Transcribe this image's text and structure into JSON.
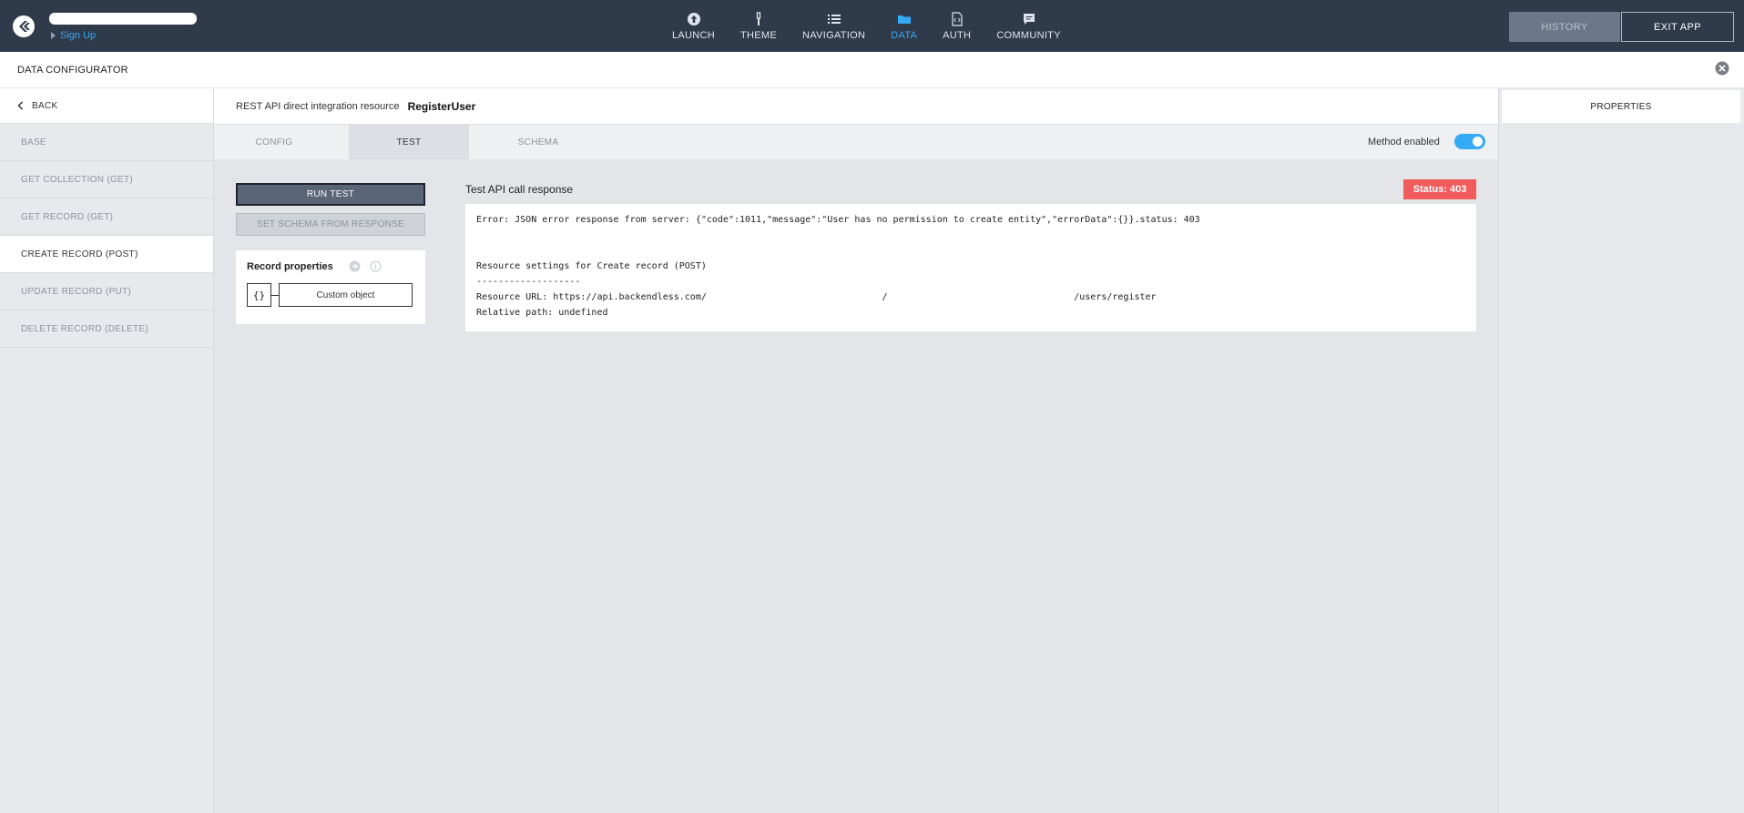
{
  "topbar": {
    "sign_up": "Sign Up",
    "nav": [
      {
        "label": "LAUNCH",
        "icon": "upload-icon"
      },
      {
        "label": "THEME",
        "icon": "brush-icon"
      },
      {
        "label": "NAVIGATION",
        "icon": "list-icon"
      },
      {
        "label": "DATA",
        "icon": "folder-icon",
        "active": true
      },
      {
        "label": "AUTH",
        "icon": "code-file-icon"
      },
      {
        "label": "COMMUNITY",
        "icon": "chat-icon"
      }
    ],
    "history_label": "HISTORY",
    "exit_label": "EXIT APP"
  },
  "configurator": {
    "title": "DATA CONFIGURATOR"
  },
  "sidebar": {
    "back_label": "BACK",
    "items": [
      {
        "label": "BASE"
      },
      {
        "label": "GET COLLECTION (GET)"
      },
      {
        "label": "GET RECORD (GET)"
      },
      {
        "label": "CREATE RECORD (POST)",
        "active": true
      },
      {
        "label": "UPDATE RECORD (PUT)"
      },
      {
        "label": "DELETE RECORD (DELETE)"
      }
    ]
  },
  "main": {
    "resource_prefix": "REST API direct integration resource",
    "resource_name": "RegisterUser",
    "tabs": [
      {
        "label": "CONFIG"
      },
      {
        "label": "TEST",
        "active": true
      },
      {
        "label": "SCHEMA"
      }
    ],
    "method_enabled_label": "Method enabled",
    "method_enabled": true,
    "run_test_label": "RUN TEST",
    "set_schema_label": "SET SCHEMA FROM RESPONSE",
    "record_properties_title": "Record properties",
    "object_icon_text": "{}",
    "object_type_label": "Custom object",
    "response_title": "Test API call response",
    "status_label": "Status: 403",
    "response_lines": [
      "Error: JSON error response from server: {\"code\":1011,\"message\":\"User has no permission to create entity\",\"errorData\":{}}.status: 403",
      "",
      "",
      "Resource settings for Create record (POST)",
      "-------------------",
      "Resource URL: https://api.backendless.com/                                /                                  /users/register",
      "Relative path: undefined"
    ]
  },
  "properties": {
    "tab_label": "PROPERTIES"
  },
  "colors": {
    "topbar_bg": "#2f3a4a",
    "accent": "#34a9f4",
    "status_error": "#f15b5b"
  }
}
